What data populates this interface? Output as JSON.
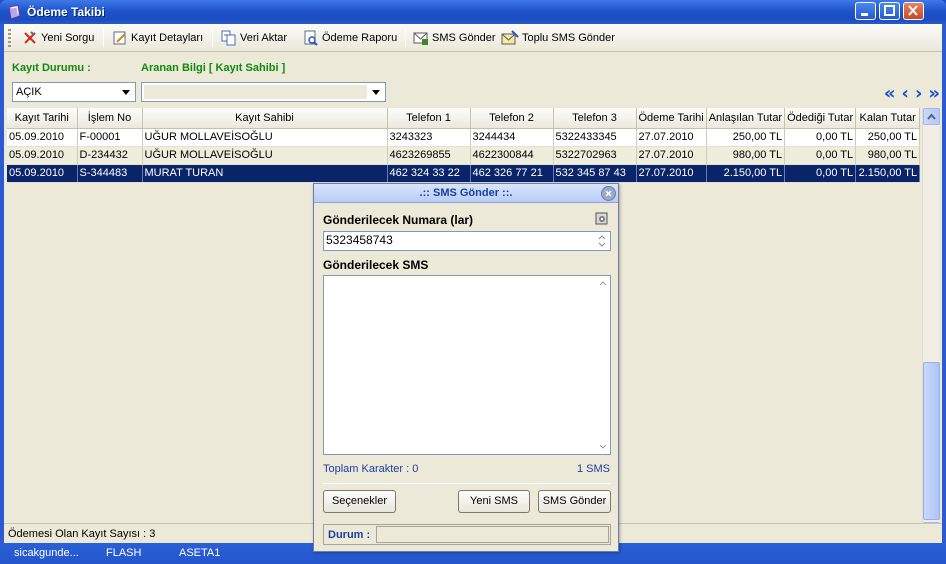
{
  "window": {
    "title": "Ödeme Takibi"
  },
  "toolbar": {
    "new_query": "Yeni Sorgu",
    "record_details": "Kayıt Detayları",
    "data_transfer": "Veri Aktar",
    "payment_report": "Ödeme Raporu",
    "send_sms": "SMS Gönder",
    "bulk_sms": "Toplu SMS Gönder"
  },
  "filters": {
    "status_label": "Kayıt Durumu :",
    "status_value": "AÇIK",
    "search_label": "Aranan Bilgi [ Kayıt Sahibi ]",
    "search_value": ""
  },
  "nav": {
    "first": "«",
    "prev": "‹",
    "next": "›",
    "last": "»"
  },
  "grid": {
    "columns": [
      "Kayıt Tarihi",
      "İşlem No",
      "Kayıt Sahibi",
      "Telefon 1",
      "Telefon 2",
      "Telefon 3",
      "Ödeme Tarihi",
      "Anlaşılan Tutar",
      "Ödediği Tutar",
      "Kalan Tutar"
    ],
    "rows": [
      [
        "05.09.2010",
        "F-00001",
        "UĞUR MOLLAVEİSOĞLU",
        "3243323",
        "3244434",
        "5322433345",
        "27.07.2010",
        "250,00 TL",
        "0,00 TL",
        "250,00 TL"
      ],
      [
        "05.09.2010",
        "D-234432",
        "UĞUR MOLLAVEİSOĞLU",
        "4623269855",
        "4622300844",
        "5322702963",
        "27.07.2010",
        "980,00 TL",
        "0,00 TL",
        "980,00 TL"
      ],
      [
        "05.09.2010",
        "S-344483",
        "MURAT TURAN",
        "462 324 33 22",
        "462 326 77 21",
        "532 345 87 43",
        "27.07.2010",
        "2.150,00 TL",
        "0,00 TL",
        "2.150,00 TL"
      ]
    ],
    "selected_row": 2
  },
  "status": {
    "record_count": "Ödemesi Olan Kayıt Sayısı : 3"
  },
  "taskbar": {
    "item1": "sicakgunde...",
    "item2": "FLASH",
    "item3": "ASETA1"
  },
  "sms_dialog": {
    "title": ".:: SMS Gönder ::.",
    "numbers_label": "Gönderilecek Numara (lar)",
    "numbers_value": "5323458743",
    "sms_label": "Gönderilecek SMS",
    "sms_value": "",
    "char_count": "Toplam Karakter : 0",
    "sms_count": "1 SMS",
    "options_button": "Seçenekler",
    "new_sms_button": "Yeni SMS",
    "send_button": "SMS Gönder",
    "status_label": "Durum :",
    "status_value": ""
  },
  "colors": {
    "selected_row": "#0a246a",
    "label_green": "#108a10",
    "title_blue": "#1e55c9"
  }
}
